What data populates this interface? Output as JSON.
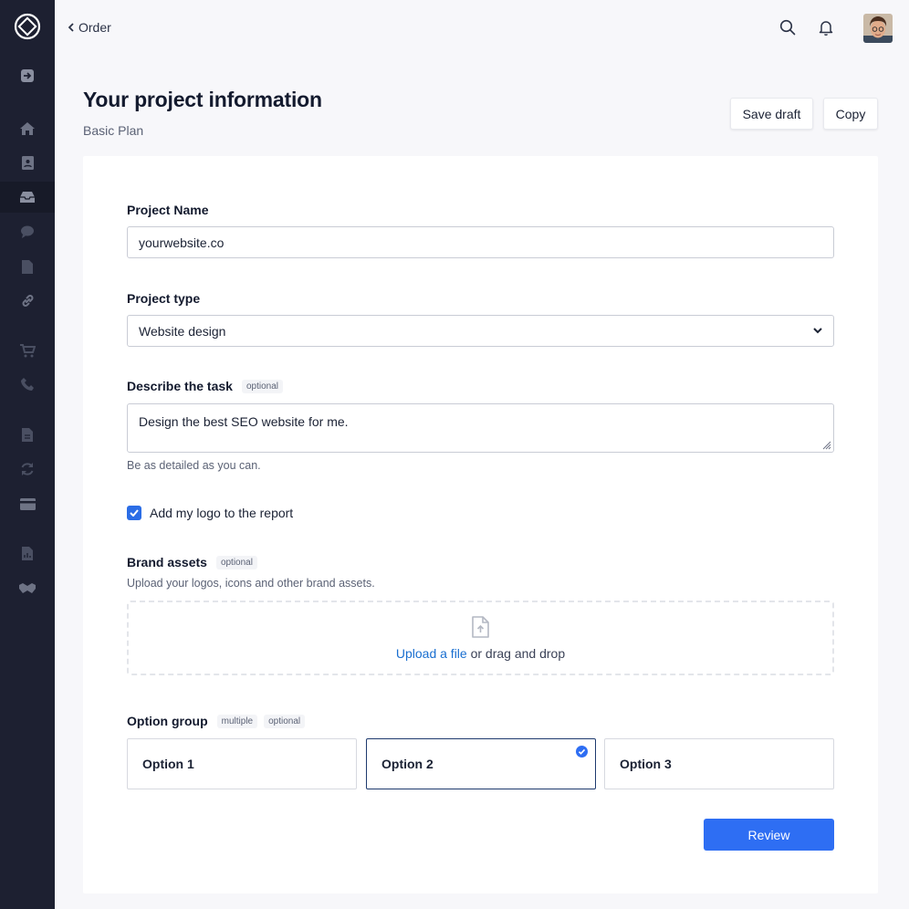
{
  "nav": {
    "back_label": "Order"
  },
  "header": {
    "title": "Your project information",
    "subtitle": "Basic Plan",
    "save_draft_label": "Save draft",
    "copy_label": "Copy"
  },
  "form": {
    "project_name": {
      "label": "Project Name",
      "value": "yourwebsite.co"
    },
    "project_type": {
      "label": "Project type",
      "selected": "Website design"
    },
    "task": {
      "label": "Describe the task",
      "tag": "optional",
      "value": "Design the best SEO website for me.",
      "help": "Be as detailed as you can."
    },
    "logo_checkbox": {
      "label": "Add my logo to the report",
      "checked": true
    },
    "brand_assets": {
      "label": "Brand assets",
      "tag": "optional",
      "help": "Upload your logos, icons and other brand assets.",
      "upload_link": "Upload a file",
      "upload_rest": " or drag and drop"
    },
    "option_group": {
      "label": "Option group",
      "tag_multiple": "multiple",
      "tag_optional": "optional",
      "options": [
        {
          "label": "Option 1",
          "selected": false
        },
        {
          "label": "Option 2",
          "selected": true
        },
        {
          "label": "Option 3",
          "selected": false
        }
      ]
    },
    "review_label": "Review"
  },
  "sidebar": {
    "items": [
      {
        "name": "sign-in-icon"
      },
      {
        "name": "home-icon"
      },
      {
        "name": "contact-card-icon"
      },
      {
        "name": "inbox-icon",
        "active": true
      },
      {
        "name": "chat-icon"
      },
      {
        "name": "document-icon"
      },
      {
        "name": "link-icon"
      },
      {
        "name": "cart-icon"
      },
      {
        "name": "phone-icon"
      },
      {
        "name": "file-icon"
      },
      {
        "name": "refresh-icon"
      },
      {
        "name": "credit-card-icon"
      },
      {
        "name": "report-icon"
      },
      {
        "name": "handshake-icon"
      }
    ]
  },
  "colors": {
    "sidebar_bg": "#1d2031",
    "primary": "#2e6ef3",
    "link": "#1a6fd0",
    "selected_border": "#1e3a6e"
  }
}
